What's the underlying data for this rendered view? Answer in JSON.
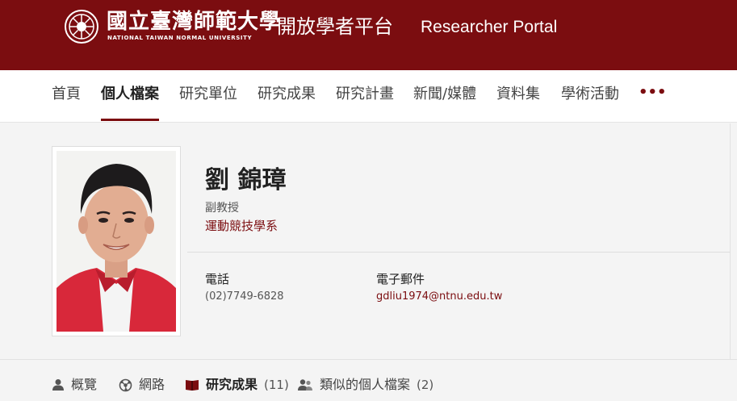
{
  "header": {
    "logo_cn": "國立臺灣師範大學",
    "logo_en": "NATIONAL TAIWAN NORMAL UNIVERSITY",
    "portal_cn": "開放學者平台",
    "portal_en": "Researcher Portal",
    "brand_color": "#7b0d10"
  },
  "nav": {
    "items": [
      {
        "label": "首頁"
      },
      {
        "label": "個人檔案",
        "active": true
      },
      {
        "label": "研究單位"
      },
      {
        "label": "研究成果"
      },
      {
        "label": "研究計畫"
      },
      {
        "label": "新聞/媒體"
      },
      {
        "label": "資料集"
      },
      {
        "label": "學術活動"
      }
    ],
    "more_label": "•••"
  },
  "profile": {
    "name": "劉 錦璋",
    "title": "副教授",
    "department": "運動競技學系",
    "phone_label": "電話",
    "phone": "(02)7749-6828",
    "email_label": "電子郵件",
    "email": "gdliu1974@ntnu.edu.tw"
  },
  "tabs": [
    {
      "icon": "person-icon",
      "label": "概覽",
      "count": ""
    },
    {
      "icon": "network-icon",
      "label": "網路",
      "count": ""
    },
    {
      "icon": "book-icon",
      "label": "研究成果",
      "count": "(11)",
      "active": true
    },
    {
      "icon": "similar-people-icon",
      "label": "類似的個人檔案",
      "count": "(2)"
    }
  ]
}
